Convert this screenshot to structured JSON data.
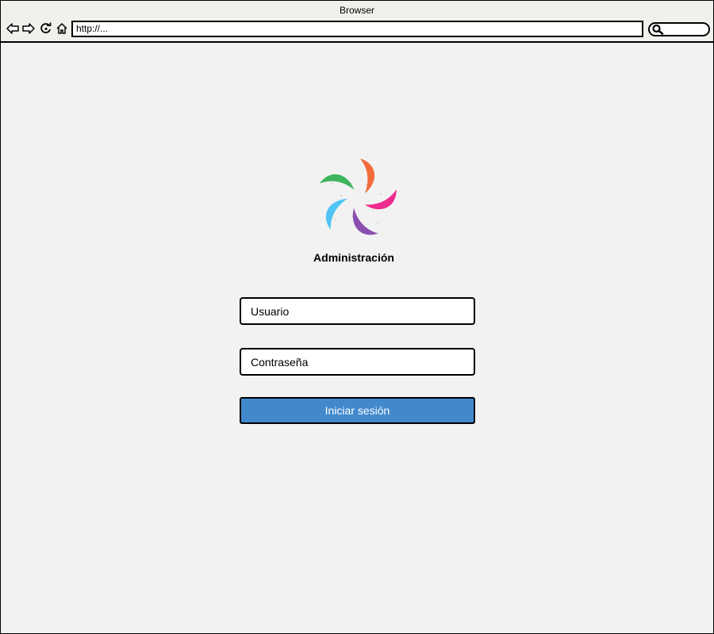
{
  "window": {
    "title": "Browser"
  },
  "toolbar": {
    "address": "http://...",
    "icons": [
      "back-arrow-icon",
      "forward-arrow-icon",
      "reload-icon",
      "home-icon",
      "search-icon"
    ]
  },
  "login": {
    "title": "Administración",
    "username_placeholder": "Usuario",
    "password_placeholder": "Contraseña",
    "submit_label": "Iniciar sesión"
  },
  "colors": {
    "background": "#f2f2f2",
    "button": "#4289cc",
    "logo_green": "#3db55e",
    "logo_orange": "#f26b3a",
    "logo_pink": "#ee2b8f",
    "logo_purple": "#8b4fb0",
    "logo_blue": "#4fc4f5"
  }
}
